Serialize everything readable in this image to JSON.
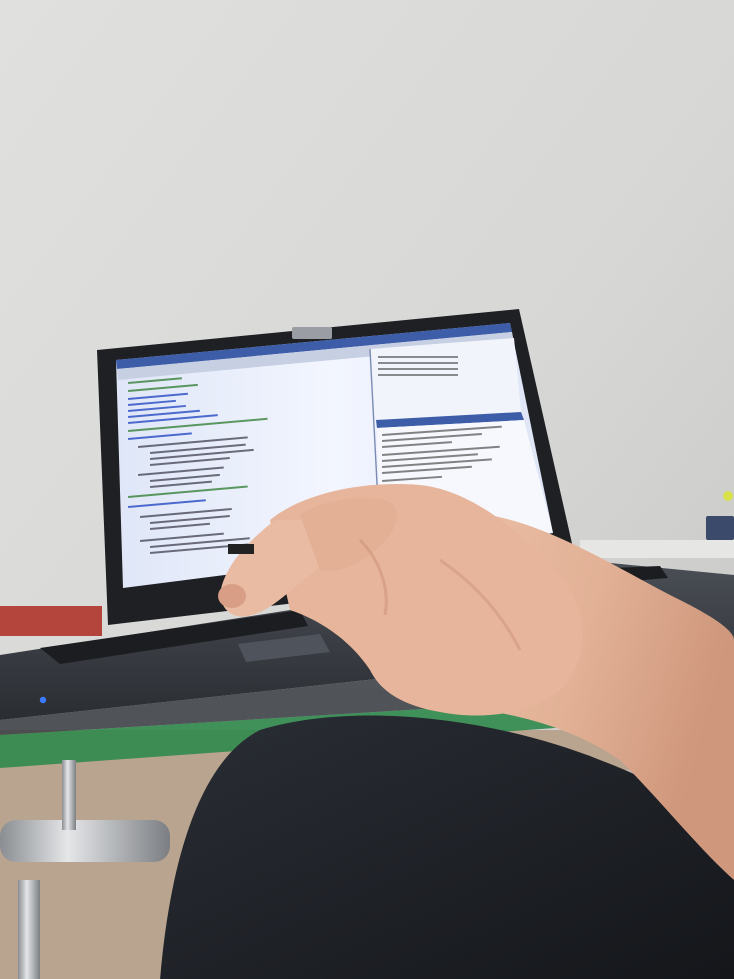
{
  "scene": {
    "kind": "photo",
    "subject": "laptop-on-glass-desk-with-hand"
  },
  "colors": {
    "wall": "#d6d6d4",
    "wall_shadow": "#c9c9c8",
    "laptop_body": "#2b2e33",
    "laptop_deck": "#3d4046",
    "screen_glow": "#e8eefc",
    "editor_blue": "#3d5da8",
    "skin": "#e6b8a0",
    "skin_shadow": "#c98d75",
    "jeans": "#1c1f24",
    "glass_edge": "#2f8a4c",
    "chrome": "#b9bbbe",
    "power_led": "#3a7bff"
  },
  "screen": {
    "keyword_color": "#1a3fbf",
    "comment_color": "#2b7a2b"
  }
}
